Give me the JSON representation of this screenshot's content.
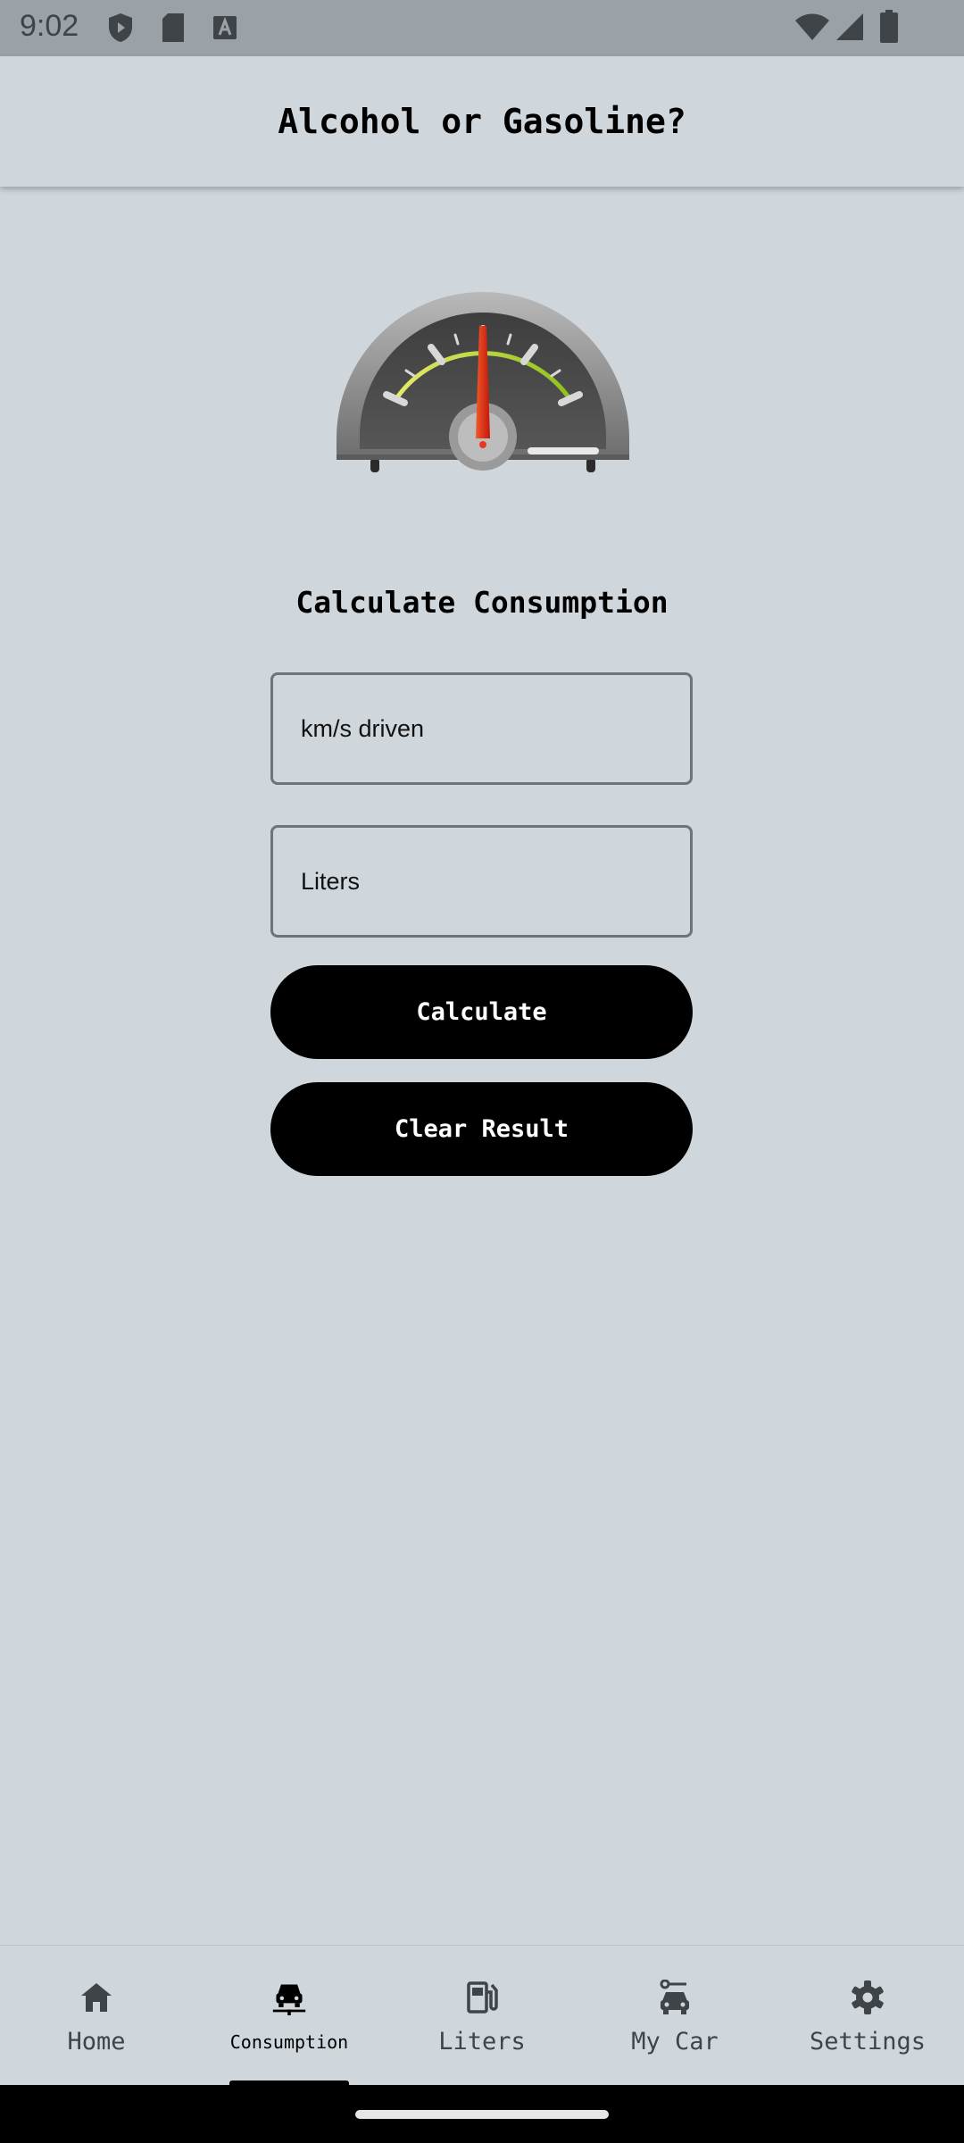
{
  "status_bar": {
    "time": "9:02",
    "left_icons": [
      "shield-play-icon",
      "sd-card-icon",
      "text-a-icon"
    ],
    "right_icons": [
      "wifi-icon",
      "signal-icon",
      "battery-icon"
    ]
  },
  "app_bar": {
    "title": "Alcohol or Gasoline?"
  },
  "main": {
    "gauge_icon": "speedometer-icon",
    "section_title": "Calculate Consumption",
    "km_field": {
      "placeholder": "km/s driven",
      "value": ""
    },
    "liters_field": {
      "placeholder": "Liters",
      "value": ""
    },
    "calculate_label": "Calculate",
    "clear_label": "Clear Result"
  },
  "bottom_nav": {
    "active": "Consumption",
    "items": [
      {
        "label": "Home",
        "icon": "home-icon"
      },
      {
        "label": "Consumption",
        "icon": "car-icon"
      },
      {
        "label": "Liters",
        "icon": "fuel-pump-icon"
      },
      {
        "label": "My Car",
        "icon": "car-wrench-icon"
      },
      {
        "label": "Settings",
        "icon": "gear-icon"
      }
    ]
  },
  "colors": {
    "background": "#cfd7dd",
    "button": "#000000",
    "button_text": "#ffffff",
    "needle": "#e53a1f"
  }
}
